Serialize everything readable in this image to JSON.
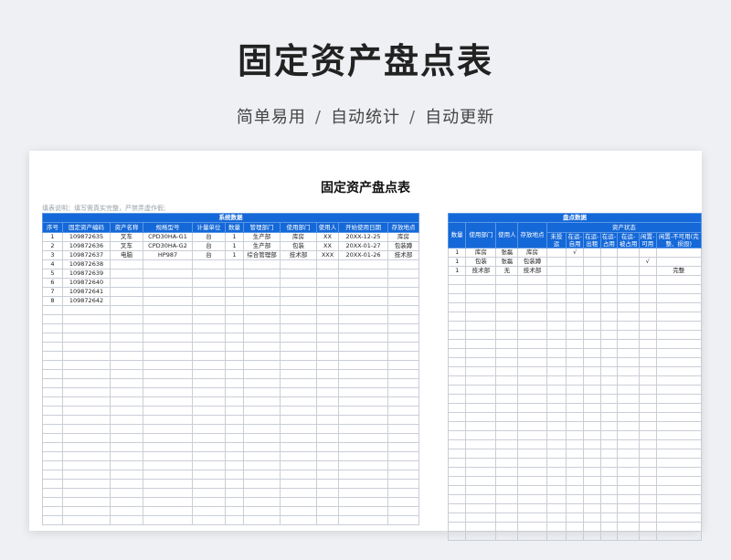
{
  "hero": {
    "title": "固定资产盘点表",
    "subtitle_parts": [
      "简单易用",
      "/",
      "自动统计",
      "/",
      "自动更新"
    ]
  },
  "sheet": {
    "title": "固定资产盘点表",
    "note": "填表说明：填写需真实完整，严禁弄虚作假;"
  },
  "left": {
    "group_header": "系统数据",
    "columns": [
      "序号",
      "固定资产编码",
      "资产名称",
      "规格型号",
      "计量单位",
      "数量",
      "管理部门",
      "使用部门",
      "使用人",
      "开始使用日期",
      "存放地点"
    ],
    "rows": [
      [
        "1",
        "109872635",
        "叉车",
        "CPD30HA-G1",
        "台",
        "1",
        "生产部",
        "库房",
        "XX",
        "20XX-12-25",
        "库房"
      ],
      [
        "2",
        "109872636",
        "叉车",
        "CPD30HA-G2",
        "台",
        "1",
        "生产部",
        "包装",
        "XX",
        "20XX-01-27",
        "包装蹲"
      ],
      [
        "3",
        "109872637",
        "电脑",
        "HP987",
        "台",
        "1",
        "综合管理部",
        "技术部",
        "XXX",
        "20XX-01-26",
        "技术部"
      ],
      [
        "4",
        "109872638",
        "",
        "",
        "",
        "",
        "",
        "",
        "",
        "",
        ""
      ],
      [
        "5",
        "109872639",
        "",
        "",
        "",
        "",
        "",
        "",
        "",
        "",
        ""
      ],
      [
        "6",
        "109872640",
        "",
        "",
        "",
        "",
        "",
        "",
        "",
        "",
        ""
      ],
      [
        "7",
        "109872641",
        "",
        "",
        "",
        "",
        "",
        "",
        "",
        "",
        ""
      ],
      [
        "8",
        "109872642",
        "",
        "",
        "",
        "",
        "",
        "",
        "",
        "",
        ""
      ]
    ]
  },
  "right": {
    "group_header": "盘点数据",
    "columns": [
      "数量",
      "使用部门",
      "使用人",
      "存放地点"
    ],
    "status_group": "资产状态",
    "status_columns": [
      "未投运",
      "在运-自用",
      "在运-出租",
      "在运-占用",
      "在运-被占用",
      "闲置-可用",
      "闲置-不可用(完整、损毁)"
    ],
    "rows": [
      [
        "1",
        "库房",
        "张磊",
        "库房",
        "",
        "√",
        "",
        "",
        "",
        "",
        ""
      ],
      [
        "1",
        "包装",
        "张磊",
        "包装蹲",
        "",
        "",
        "",
        "",
        "",
        "√",
        ""
      ],
      [
        "1",
        "技术部",
        "无",
        "技术部",
        "",
        "",
        "",
        "",
        "",
        "",
        "完整"
      ]
    ]
  }
}
